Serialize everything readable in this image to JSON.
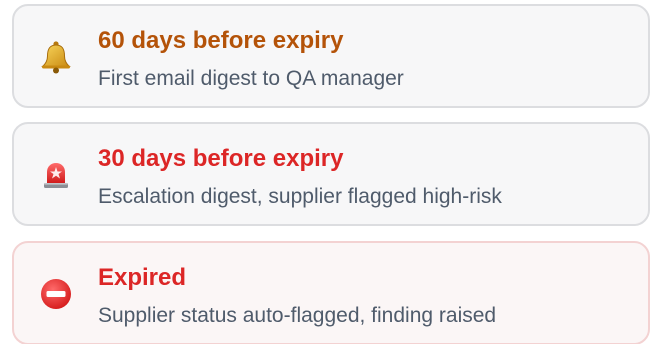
{
  "reminders": [
    {
      "title": "60 days before expiry",
      "description": "First email digest to QA manager",
      "icon": "bell-icon",
      "title_color": "#b45309"
    },
    {
      "title": "30 days before expiry",
      "description": "Escalation digest, supplier flagged high-risk",
      "icon": "police-light-icon",
      "title_color": "#dc2626"
    },
    {
      "title": "Expired",
      "description": "Supplier status auto-flagged, finding raised",
      "icon": "no-entry-icon",
      "title_color": "#dc2626"
    }
  ]
}
